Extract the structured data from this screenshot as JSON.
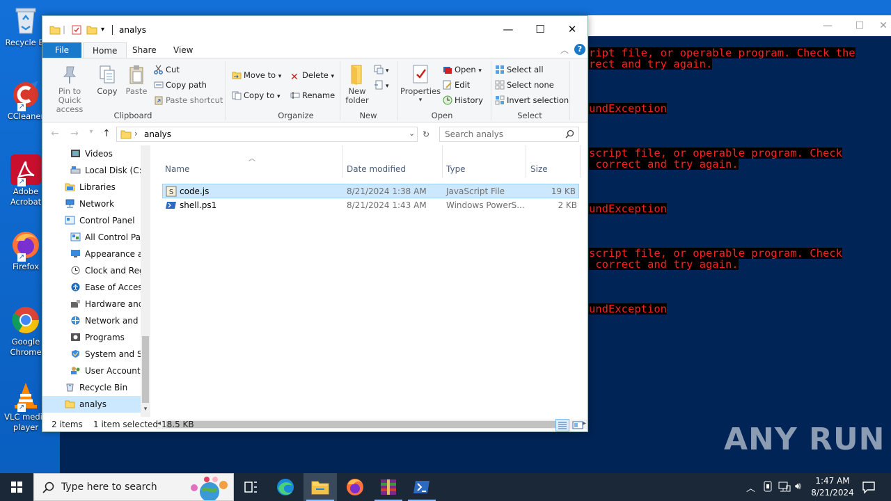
{
  "desktop": {
    "icons": [
      {
        "label": "Recycle Bin",
        "shown": "Recycle Bi"
      },
      {
        "label": "CCleaner"
      },
      {
        "label": "Adobe Acrobat",
        "line1": "Adobe",
        "line2": "Acrobat"
      },
      {
        "label": "Firefox"
      },
      {
        "label": "Google Chrome",
        "line1": "Google",
        "line2": "Chrome"
      },
      {
        "label": "VLC media player",
        "line1": "VLC media",
        "line2": "player"
      }
    ]
  },
  "powershell": {
    "lines": [
      "ript file, or operable program. Check the",
      "rect and try again.",
      "undException",
      "script file, or operable program. Check",
      " correct and try again.",
      "undException",
      "script file, or operable program. Check",
      " correct and try again.",
      "undException"
    ]
  },
  "watermark": "ANY RUN",
  "explorer": {
    "title": "analys",
    "tabs": {
      "file": "File",
      "home": "Home",
      "share": "Share",
      "view": "View"
    },
    "clipboard": {
      "pin": "Pin to Quick access",
      "pin_l1": "Pin to Quick",
      "pin_l2": "access",
      "copy": "Copy",
      "paste": "Paste",
      "cut": "Cut",
      "copy_path": "Copy path",
      "paste_shortcut": "Paste shortcut",
      "label": "Clipboard"
    },
    "organize": {
      "move_to": "Move to",
      "copy_to": "Copy to",
      "delete": "Delete",
      "rename": "Rename",
      "label": "Organize"
    },
    "new": {
      "new_folder_l1": "New",
      "new_folder_l2": "folder",
      "label": "New"
    },
    "open": {
      "properties": "Properties",
      "open": "Open",
      "edit": "Edit",
      "history": "History",
      "label": "Open"
    },
    "select": {
      "select_all": "Select all",
      "select_none": "Select none",
      "invert": "Invert selection",
      "label": "Select"
    },
    "address": {
      "path": "analys",
      "search_placeholder": "Search analys"
    },
    "nav": [
      {
        "label": "Videos"
      },
      {
        "label": "Local Disk (C:)"
      },
      {
        "label": "Libraries"
      },
      {
        "label": "Network"
      },
      {
        "label": "Control Panel"
      },
      {
        "label": "All Control Par"
      },
      {
        "label": "Appearance an"
      },
      {
        "label": "Clock and Regi"
      },
      {
        "label": "Ease of Access"
      },
      {
        "label": "Hardware and"
      },
      {
        "label": "Network and Ir"
      },
      {
        "label": "Programs"
      },
      {
        "label": "System and Sec"
      },
      {
        "label": "User Accounts"
      },
      {
        "label": "Recycle Bin"
      },
      {
        "label": "analys"
      }
    ],
    "columns": {
      "name": "Name",
      "date": "Date modified",
      "type": "Type",
      "size": "Size"
    },
    "files": [
      {
        "name": "code.js",
        "date": "8/21/2024 1:38 AM",
        "type": "JavaScript File",
        "size": "19 KB",
        "selected": true
      },
      {
        "name": "shell.ps1",
        "date": "8/21/2024 1:43 AM",
        "type": "Windows PowerS...",
        "size": "2 KB",
        "selected": false
      }
    ],
    "status": {
      "items": "2 items",
      "selected": "1 item selected",
      "size": "18.5 KB"
    }
  },
  "taskbar": {
    "search_placeholder": "Type here to search",
    "time": "1:47 AM",
    "date": "8/21/2024"
  },
  "colors": {
    "desktop": "#0a64c8",
    "ps_background": "#012456",
    "ps_error": "#ff2020",
    "file_tab": "#1979ca",
    "selection": "#cce8ff",
    "taskbar": "#1b2837"
  }
}
